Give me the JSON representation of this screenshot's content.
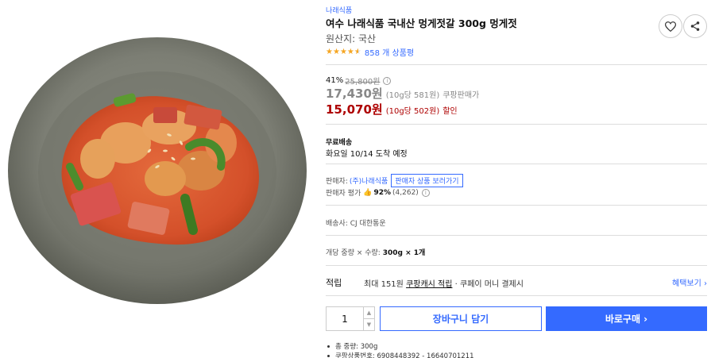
{
  "product": {
    "brand": "나래식품",
    "title": "여수 나래식품 국내산 멍게젓갈 300g 멍게젓",
    "origin": "원산지: 국산",
    "rating": 4.5,
    "review_count": "858 개 상품평",
    "image_icon": "food-photo-icon"
  },
  "actions": {
    "wishlist_icon": "heart-icon",
    "share_icon": "share-icon"
  },
  "price": {
    "discount_rate": "41%",
    "original_price": "25,800원",
    "sale_price": "17,430원",
    "sale_unit": "(10g당 581원)",
    "sale_label": "쿠팡판매가",
    "member_price": "15,070원",
    "member_unit": "(10g당 502원)",
    "member_label": "할인"
  },
  "shipping": {
    "title": "무료배송",
    "arrival": "화요일 10/14 도착 예정"
  },
  "seller": {
    "label": "판매자:",
    "name": "(주)나래식품",
    "view_products_button": "판매자 상품 보러가기",
    "rating_label": "판매자 평가",
    "rating_pct": "92%",
    "rating_count": "(4,262)"
  },
  "courier": "배송사: CJ 대한통운",
  "quantity_info": {
    "label": "개당 중량 × 수량:",
    "value": "300g × 1개"
  },
  "reward": {
    "label": "적립",
    "text_prefix": "최대 151원",
    "text_link": "쿠팡캐시 적립",
    "text_suffix": "· 쿠페이 머니 결제시",
    "benefit_link": "혜택보기 ›"
  },
  "purchase": {
    "quantity": "1",
    "cart_button": "장바구니 담기",
    "buy_button": "바로구매 ›"
  },
  "details": [
    "총 중량: 300g",
    "쿠팡상품번호: 6908448392 - 16640701211"
  ],
  "colors": {
    "accent": "#346aff",
    "sale_red": "#ae0000",
    "star": "#f5a623"
  }
}
